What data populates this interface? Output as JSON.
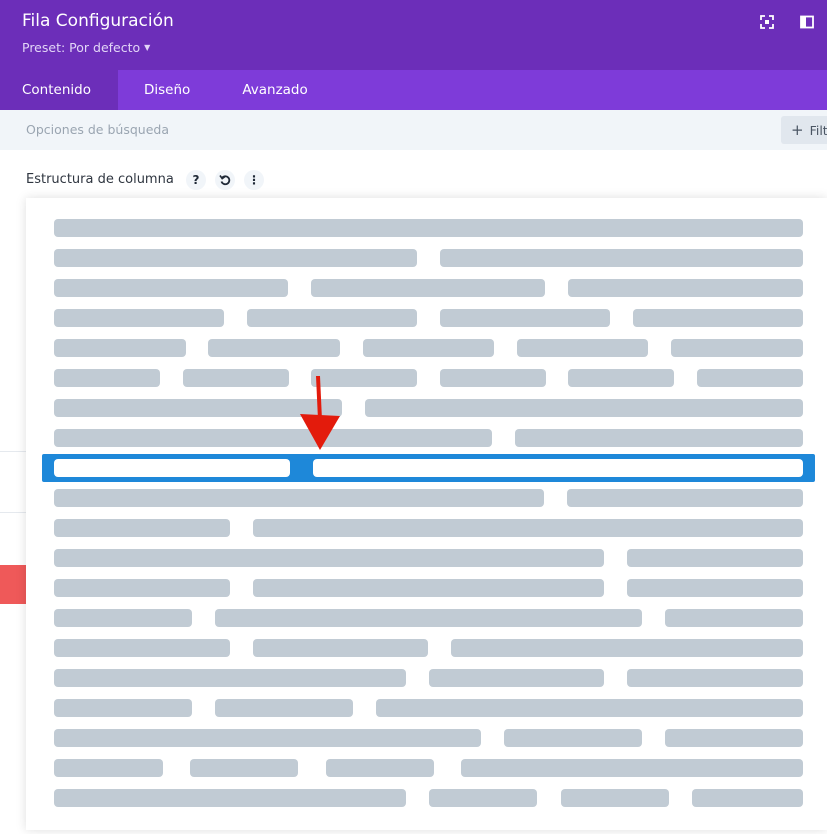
{
  "header": {
    "title": "Fila Configuración",
    "preset": "Preset: Por defecto",
    "icons": [
      "expand-icon",
      "sidebar-toggle-icon"
    ]
  },
  "tabs": [
    {
      "label": "Contenido",
      "active": true
    },
    {
      "label": "Diseño",
      "active": false
    },
    {
      "label": "Avanzado",
      "active": false
    }
  ],
  "search": {
    "placeholder": "Opciones de búsqueda",
    "filter_label": "Filt"
  },
  "section": {
    "label": "Estructura de columna",
    "icons": [
      "help-icon",
      "reset-icon",
      "more-options-icon"
    ]
  },
  "layouts": [
    {
      "cols": "1"
    },
    {
      "cols": "1/2 + 1/2"
    },
    {
      "cols": "1/3 + 1/3 + 1/3"
    },
    {
      "cols": "1/4 + 1/4 + 1/4 + 1/4"
    },
    {
      "cols": "1/5 x5"
    },
    {
      "cols": "1/6 x6"
    },
    {
      "cols": "2/5 + 3/5"
    },
    {
      "cols": "3/5 + 2/5"
    },
    {
      "cols": "1/3 + 2/3",
      "selected": true
    },
    {
      "cols": "2/3 + 1/3"
    },
    {
      "cols": "1/4 + 3/4"
    },
    {
      "cols": "3/4 + 1/4"
    },
    {
      "cols": "1/4 + 1/2 + 1/4"
    },
    {
      "cols": "1/5 + 3/5 + 1/5"
    },
    {
      "cols": "1/4 + 1/4 + 1/2"
    },
    {
      "cols": "1/2 + 1/4 + 1/4"
    },
    {
      "cols": "1/5 + 1/5 + 3/5"
    },
    {
      "cols": "3/5 + 1/5 + 1/5"
    },
    {
      "cols": "1/6 + 1/6 + 1/6 + 1/2"
    },
    {
      "cols": "1/2 + 1/6 + 1/6 + 1/6"
    }
  ],
  "colors": {
    "header": "#6c2eb9",
    "tabs": "#7e3bd9",
    "selected_row": "#1e88d9",
    "segment": "#c1cbd4"
  }
}
